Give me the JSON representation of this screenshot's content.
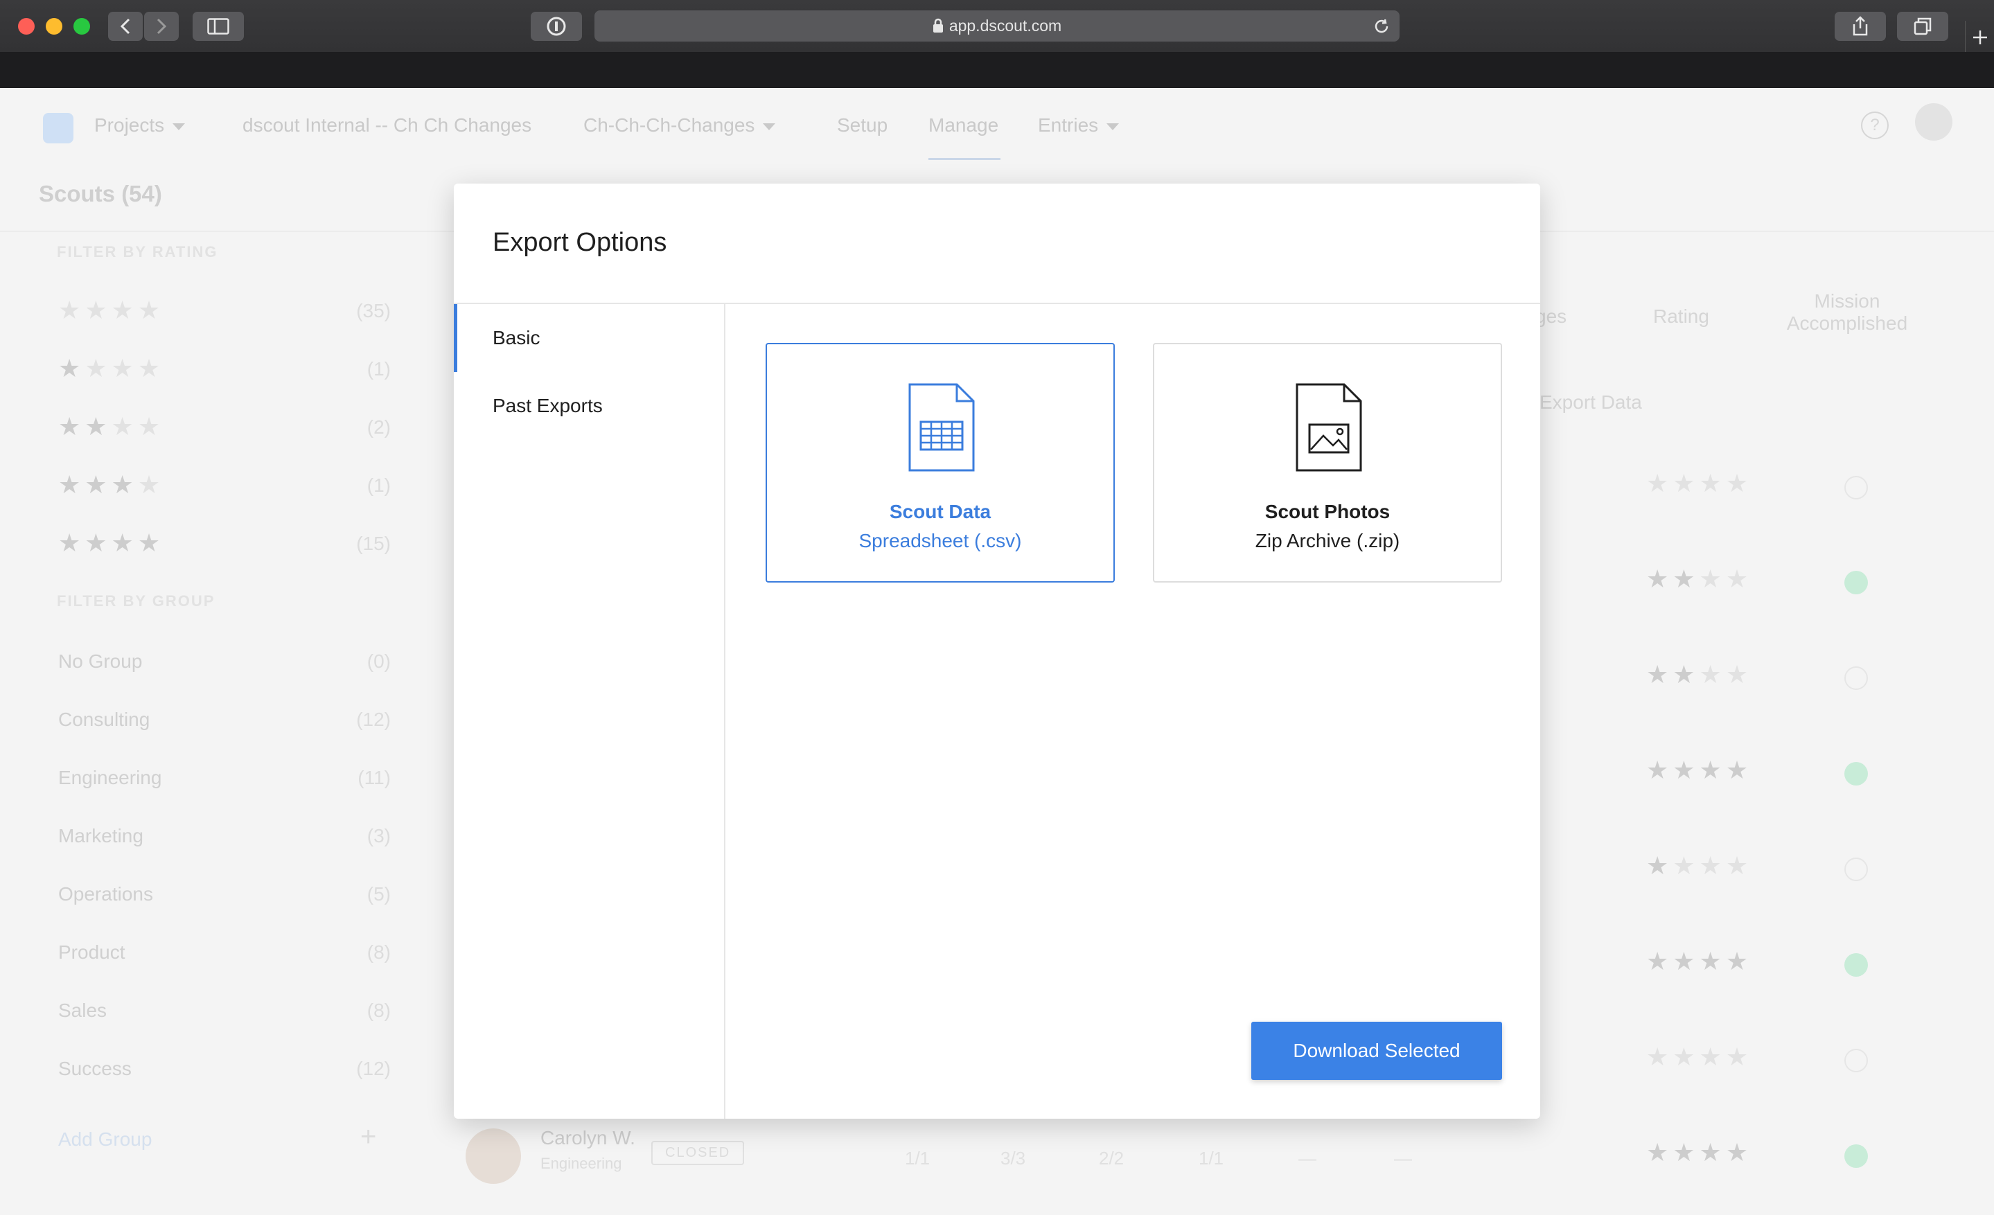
{
  "browser": {
    "url": "app.dscout.com"
  },
  "nav": {
    "projects": "Projects",
    "project_name": "dscout Internal -- Ch Ch Changes",
    "mission": "Ch-Ch-Ch-Changes",
    "setup": "Setup",
    "manage": "Manage",
    "entries": "Entries",
    "help": "?"
  },
  "page": {
    "title": "Scouts (54)"
  },
  "sidebar": {
    "rating_heading": "FILTER BY RATING",
    "rating_counts": [
      "(35)",
      "(1)",
      "(2)",
      "(1)",
      "(15)"
    ],
    "group_heading": "FILTER BY GROUP",
    "groups": [
      {
        "label": "No Group",
        "count": "(0)"
      },
      {
        "label": "Consulting",
        "count": "(12)"
      },
      {
        "label": "Engineering",
        "count": "(11)"
      },
      {
        "label": "Marketing",
        "count": "(3)"
      },
      {
        "label": "Operations",
        "count": "(5)"
      },
      {
        "label": "Product",
        "count": "(8)"
      },
      {
        "label": "Sales",
        "count": "(8)"
      },
      {
        "label": "Success",
        "count": "(12)"
      }
    ],
    "add_group": "Add Group",
    "add_icon": "+"
  },
  "table": {
    "col_ges": "ges",
    "col_rating": "Rating",
    "col_mission_1": "Mission",
    "col_mission_2": "Accomplished",
    "export_data": "Export Data",
    "last_row": {
      "name": "Carolyn W.",
      "group": "Engineering",
      "status": "CLOSED",
      "nums": [
        "1/1",
        "3/3",
        "2/2",
        "1/1",
        "—",
        "—"
      ]
    }
  },
  "modal": {
    "title": "Export Options",
    "tabs": [
      {
        "label": "Basic",
        "active": true
      },
      {
        "label": "Past Exports",
        "active": false
      }
    ],
    "options": [
      {
        "title": "Scout Data",
        "subtitle": "Spreadsheet (.csv)",
        "icon": "spreadsheet-file-icon",
        "selected": true
      },
      {
        "title": "Scout Photos",
        "subtitle": "Zip Archive (.zip)",
        "icon": "image-file-icon",
        "selected": false
      }
    ],
    "download_label": "Download Selected"
  },
  "colors": {
    "accent": "#3b7ddd",
    "button": "#3b82e6",
    "text": "#1f1f1f"
  }
}
